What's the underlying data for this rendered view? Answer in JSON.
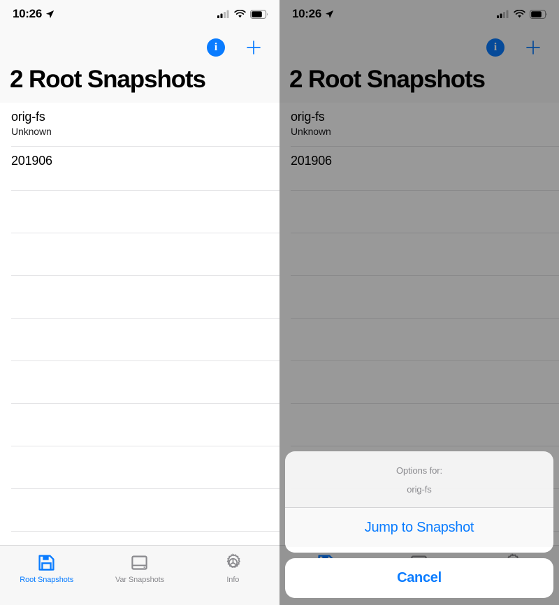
{
  "colors": {
    "accent": "#0a7cff",
    "tab_inactive": "#8a8a8e",
    "separator": "#e4e4e6",
    "header_bg": "#F9F9F9",
    "dim_overlay": "#999999"
  },
  "status_bar": {
    "time": "10:26",
    "location_icon": "location-arrow-icon",
    "signal_icon": "cellular-signal-icon",
    "signal_bars_filled": 2,
    "signal_bars_total": 4,
    "wifi_icon": "wifi-icon",
    "battery_icon": "battery-icon",
    "battery_level": 70
  },
  "nav": {
    "info_button_label": "i",
    "info_icon": "info-circle-icon",
    "add_icon": "plus-icon"
  },
  "title": "2 Root Snapshots",
  "list": {
    "rows": [
      {
        "title": "orig-fs",
        "subtitle": "Unknown"
      },
      {
        "title": "201906",
        "subtitle": ""
      }
    ],
    "empty_row_count": 9
  },
  "tabs": [
    {
      "label": "Root Snapshots",
      "icon": "floppy-disk-icon",
      "active": true
    },
    {
      "label": "Var Snapshots",
      "icon": "disk-drive-icon",
      "active": false
    },
    {
      "label": "Info",
      "icon": "gear-icon",
      "active": false
    }
  ],
  "action_sheet": {
    "header_title": "Options for:",
    "header_subtitle": "orig-fs",
    "actions": [
      {
        "label": "Jump to Snapshot"
      }
    ],
    "cancel_label": "Cancel"
  }
}
